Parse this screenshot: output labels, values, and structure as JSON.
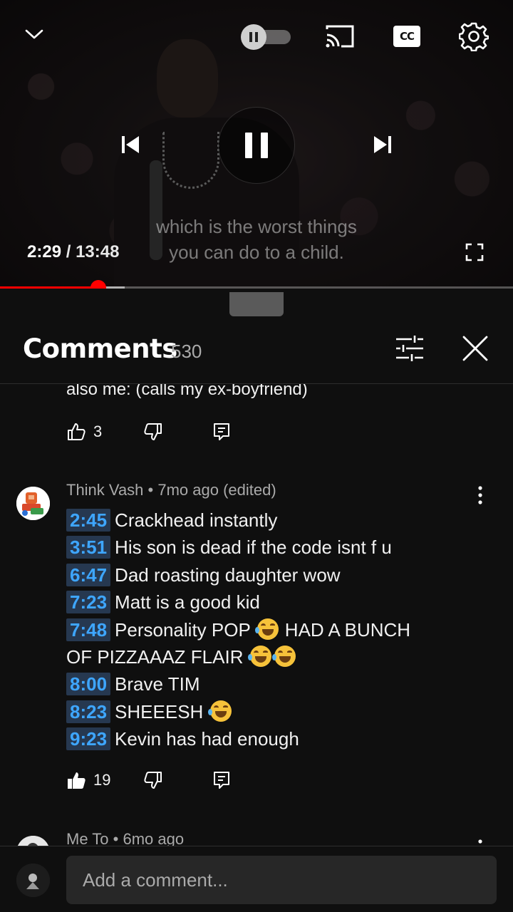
{
  "player": {
    "current_time": "2:29",
    "duration": "13:48",
    "time_separator": " / ",
    "caption_lines": [
      "which is the worst things",
      "you can do to a child."
    ],
    "cc_label": "CC",
    "progress_played": 0.191,
    "progress_buffered": 0.243,
    "icons": {
      "collapse": "chevron-down-icon",
      "autoplay": "autoplay-toggle-icon",
      "cast": "cast-icon",
      "captions": "closed-captions-icon",
      "settings": "gear-icon",
      "previous": "skip-previous-icon",
      "play_pause": "pause-icon",
      "next": "skip-next-icon",
      "fullscreen": "fullscreen-icon"
    },
    "accent_color": "#ff0000"
  },
  "comments_panel": {
    "title": "Comments",
    "count": "530",
    "truncated_previous": {
      "text": "also me: (calls my ex-boyfriend)",
      "likes": "3"
    },
    "comments": [
      {
        "author": "Think Vash",
        "age": "7mo ago",
        "edited": "(edited)",
        "meta_sep": " • ",
        "lines": [
          {
            "ts": "2:45",
            "text": "Crackhead instantly"
          },
          {
            "ts": "3:51",
            "text": "His son is dead if the code isnt f u"
          },
          {
            "ts": "6:47",
            "text": "Dad roasting daughter wow"
          },
          {
            "ts": "7:23",
            "text": "Matt is a good kid"
          },
          {
            "ts": "7:48",
            "text": "Personality POP",
            "emoji_after": "face-with-tears-of-joy",
            "text2": "HAD A BUNCH"
          },
          {
            "ts": "",
            "text": "OF PIZZAAAZ FLAIR",
            "emoji_count": 2
          },
          {
            "ts": "8:00",
            "text": "Brave TIM"
          },
          {
            "ts": "8:23",
            "text": "SHEEESH",
            "emoji_count": 1
          },
          {
            "ts": "9:23",
            "text": "Kevin has had enough"
          }
        ],
        "likes": "19",
        "liked": true
      },
      {
        "author": "Me To",
        "age": "6mo ago",
        "meta_sep": " • "
      }
    ],
    "timestamp_color": "#3ea6ff",
    "timestamp_bg": "#263850"
  },
  "add_comment": {
    "placeholder": "Add a comment..."
  }
}
